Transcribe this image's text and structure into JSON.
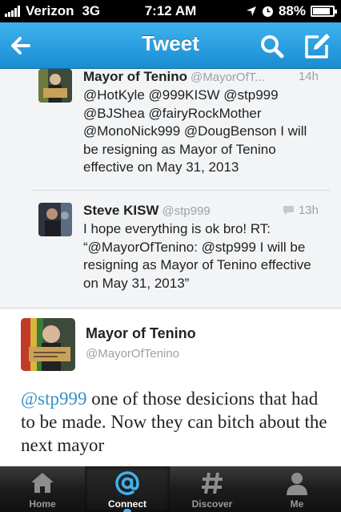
{
  "status_bar": {
    "carrier": "Verizon",
    "network": "3G",
    "time": "7:12 AM",
    "battery": "88%",
    "battery_level": 0.88
  },
  "nav": {
    "title": "Tweet",
    "back_icon": "back-arrow-icon",
    "search_icon": "search-icon",
    "compose_icon": "compose-icon",
    "bar_color": "#2a9ee0"
  },
  "replies": [
    {
      "name": "Mayor of Tenino",
      "handle": "@MayorOfT...",
      "time": "14h",
      "text": "@HotKyle @999KISW @stp999 @BJShea @fairyRockMother @MonoNick999 @DougBenson I will be resigning as Mayor of Tenino effective on May 31, 2013"
    },
    {
      "name": "Steve KISW",
      "handle": "@stp999",
      "time": "13h",
      "time_icon": "reply-bubble-icon",
      "text": "I hope everything is ok bro! RT: “@MayorOfTenino: @stp999 I will be resigning as Mayor of Tenino effective on May 31, 2013”"
    }
  ],
  "main_tweet": {
    "name": "Mayor of Tenino",
    "handle": "@MayorOfTenino",
    "mention": "@stp999",
    "text": " one of those desicions that had to be made. Now they can bitch about the next mayor",
    "mention_color": "#3a8dc4"
  },
  "tabs": [
    {
      "label": "Home",
      "icon": "home-icon",
      "active": false
    },
    {
      "label": "Connect",
      "icon": "at-sign-icon",
      "active": true
    },
    {
      "label": "Discover",
      "icon": "hashtag-icon",
      "active": false
    },
    {
      "label": "Me",
      "icon": "person-icon",
      "active": false
    }
  ]
}
